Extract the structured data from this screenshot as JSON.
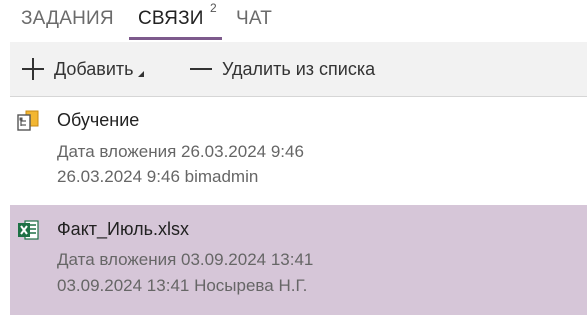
{
  "tabs": {
    "tasks": "ЗАДАНИЯ",
    "links": "СВЯЗИ",
    "links_badge": "2",
    "chat": "ЧАТ",
    "active": "links",
    "accent_color": "#7d5a8c"
  },
  "toolbar": {
    "add_label": "Добавить",
    "remove_label": "Удалить из списка",
    "icons": [
      "plus-icon",
      "caret-down-icon",
      "minus-icon"
    ]
  },
  "items": [
    {
      "title": "Обучение",
      "icon": "folder-tree-icon",
      "attached": "Дата вложения 26.03.2024 9:46",
      "meta": "26.03.2024 9:46 bimadmin",
      "selected": false
    },
    {
      "title": "Факт_Июль.xlsx",
      "icon": "excel-file-icon",
      "attached": "Дата вложения 03.09.2024 13:41",
      "meta": "03.09.2024 13:41 Носырева Н.Г.",
      "selected": true,
      "selected_color": "#d6c6d8"
    }
  ]
}
